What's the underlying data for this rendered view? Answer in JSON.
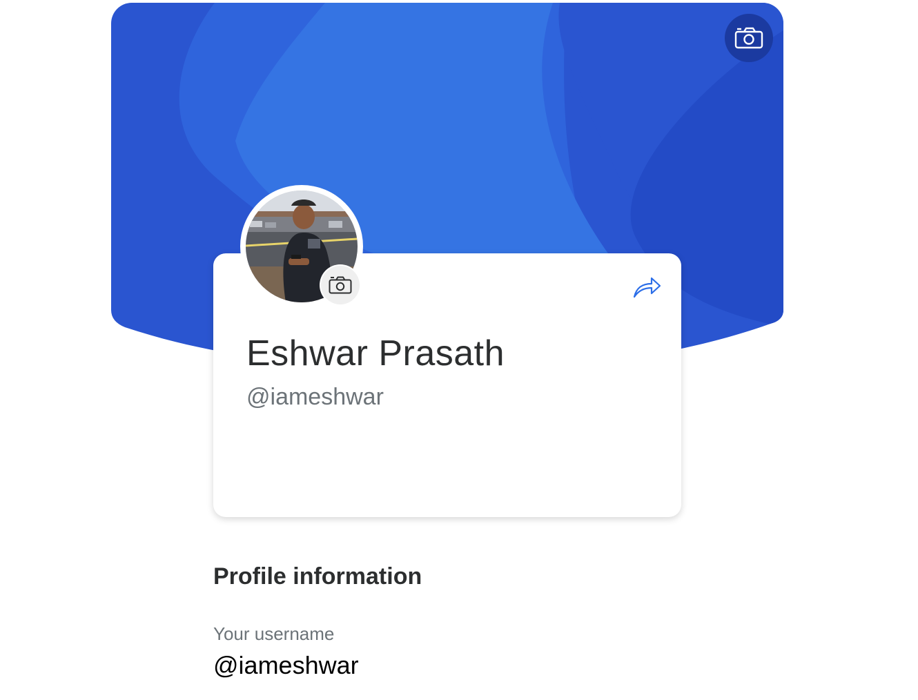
{
  "profile": {
    "display_name": "Eshwar Prasath",
    "handle": "@iameshwar"
  },
  "profile_information": {
    "title": "Profile information",
    "username_label": "Your username",
    "username_value": "@iameshwar"
  },
  "icons": {
    "cover_camera": "camera-icon",
    "avatar_camera": "camera-icon",
    "share": "share-arrow-icon"
  },
  "colors": {
    "banner_base": "#2a55d0",
    "banner_light": "#3574e3",
    "banner_dark": "#234bc6",
    "camera_button_dark": "#1b3aa0",
    "share_icon": "#2c6ee8",
    "text_primary": "#2c2e2f",
    "text_secondary": "#6c7378"
  }
}
